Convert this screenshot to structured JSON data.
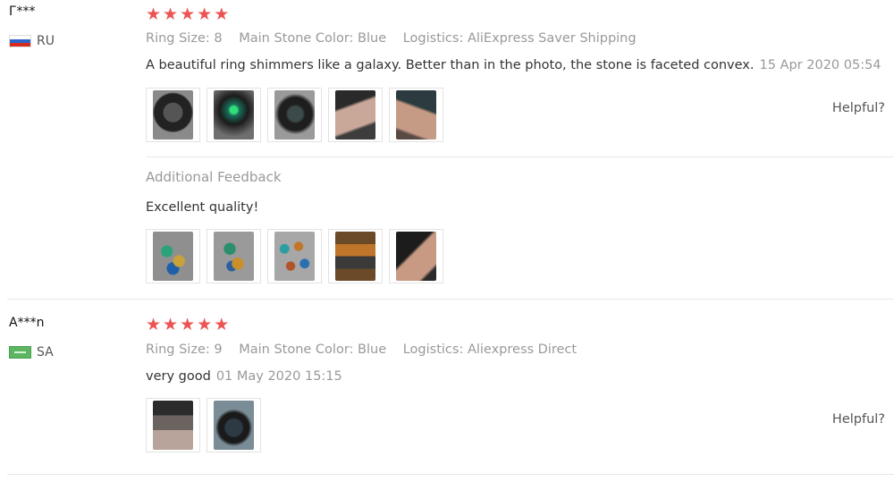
{
  "reviews": [
    {
      "user": "Г***",
      "country_code": "RU",
      "country_icon": "russia-flag-icon",
      "rating": 5,
      "props": [
        {
          "label": "Ring Size:",
          "value": "8"
        },
        {
          "label": "Main Stone Color:",
          "value": "Blue"
        },
        {
          "label": "Logistics:",
          "value": "AliExpress Saver Shipping"
        }
      ],
      "text": "A beautiful ring shimmers like a galaxy. Better than in the photo, the stone is faceted convex.",
      "date": "15 Apr 2020 05:54",
      "helpful": "Helpful?",
      "additional_title": "Additional Feedback",
      "additional_text": "Excellent quality!"
    },
    {
      "user": "A***n",
      "country_code": "SA",
      "country_icon": "saudi-arabia-flag-icon",
      "rating": 5,
      "props": [
        {
          "label": "Ring Size:",
          "value": "9"
        },
        {
          "label": "Main Stone Color:",
          "value": "Blue"
        },
        {
          "label": "Logistics:",
          "value": "Aliexpress Direct"
        }
      ],
      "text": "very good",
      "date": "01 May 2020 15:15",
      "helpful": "Helpful?"
    }
  ],
  "colors": {
    "star": "#ec5453",
    "muted_text": "#999999",
    "body_text": "#333333",
    "divider": "#e8e8e8"
  }
}
